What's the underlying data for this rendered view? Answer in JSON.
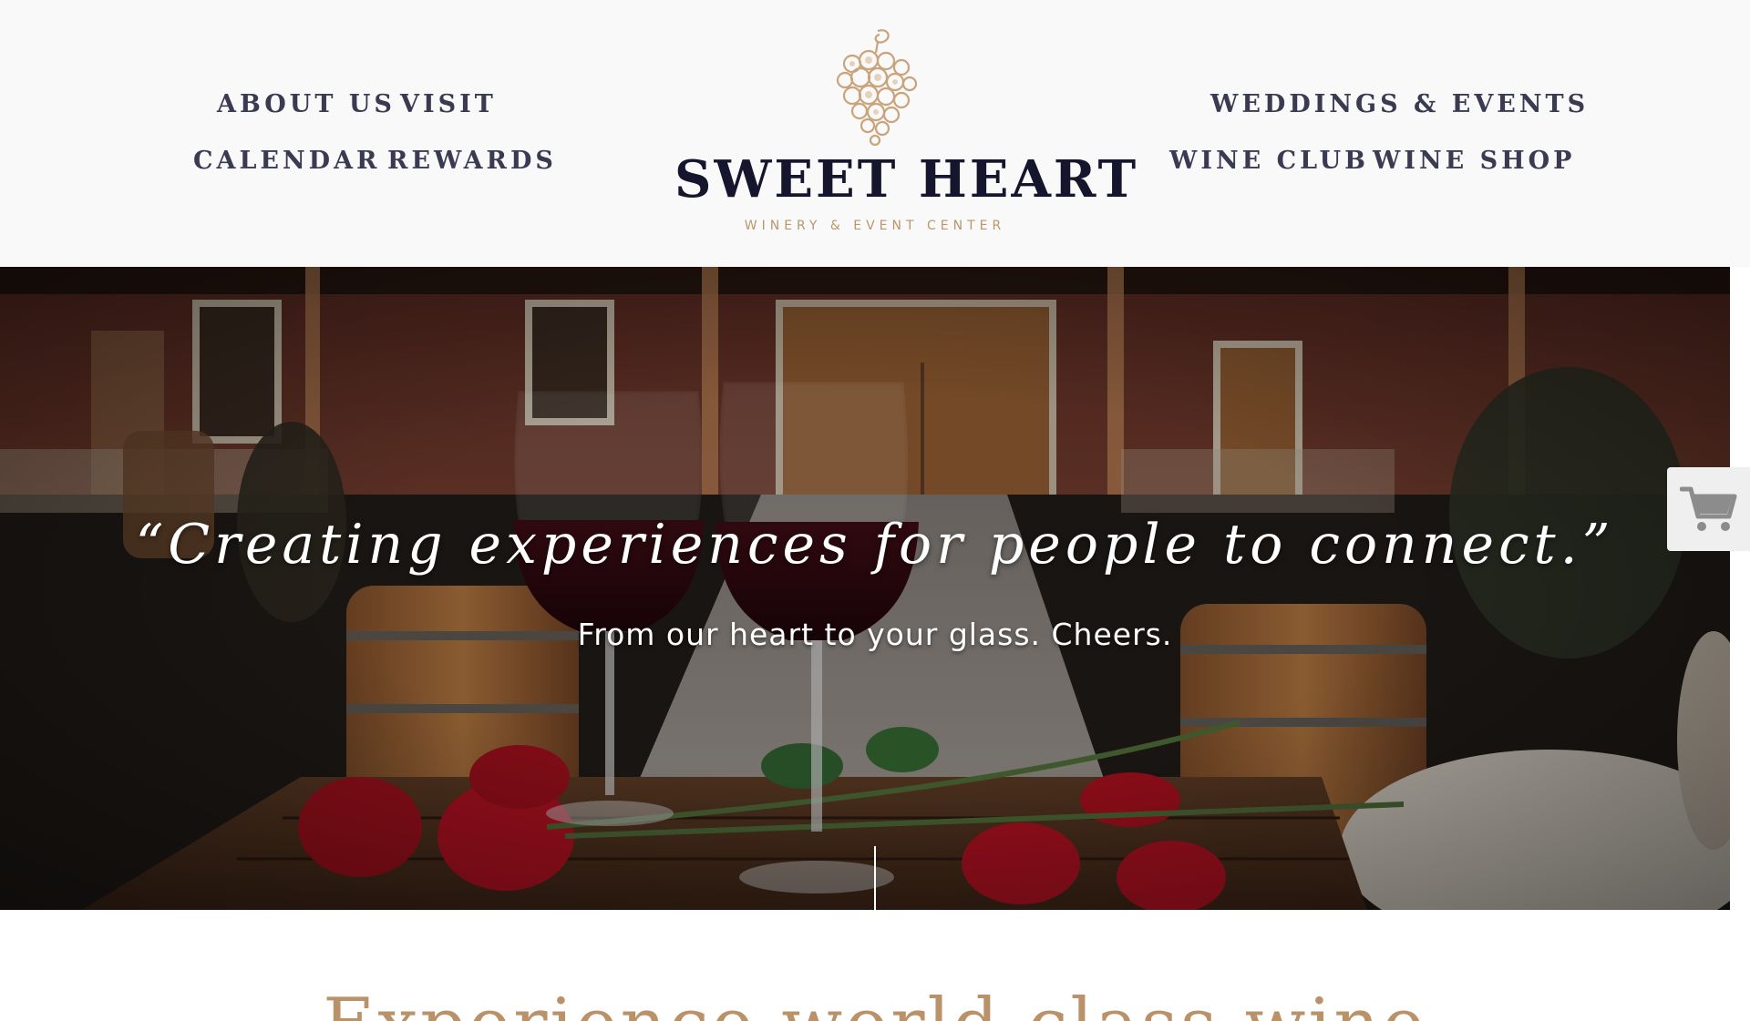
{
  "nav": {
    "about": "ABOUT US",
    "visit": "VISIT",
    "calendar": "CALENDAR",
    "rewards": "REWARDS",
    "weddings": "WEDDINGS & EVENTS",
    "wine_club": "WINE CLUB",
    "wine_shop": "WINE SHOP"
  },
  "logo": {
    "name": "SWEET HEART",
    "subtitle": "WINERY & EVENT CENTER",
    "icon": "grape-cluster-icon"
  },
  "hero": {
    "quote": "“Creating experiences for people to connect.”",
    "subtitle": "From our heart to your glass. Cheers."
  },
  "cart": {
    "icon": "shopping-cart-icon"
  },
  "section": {
    "heading": "Experience world-class wine"
  },
  "colors": {
    "nav_text": "#3a3a52",
    "logo_dark": "#16152e",
    "accent_gold": "#b8976b",
    "header_bg": "#f9f9f9"
  }
}
